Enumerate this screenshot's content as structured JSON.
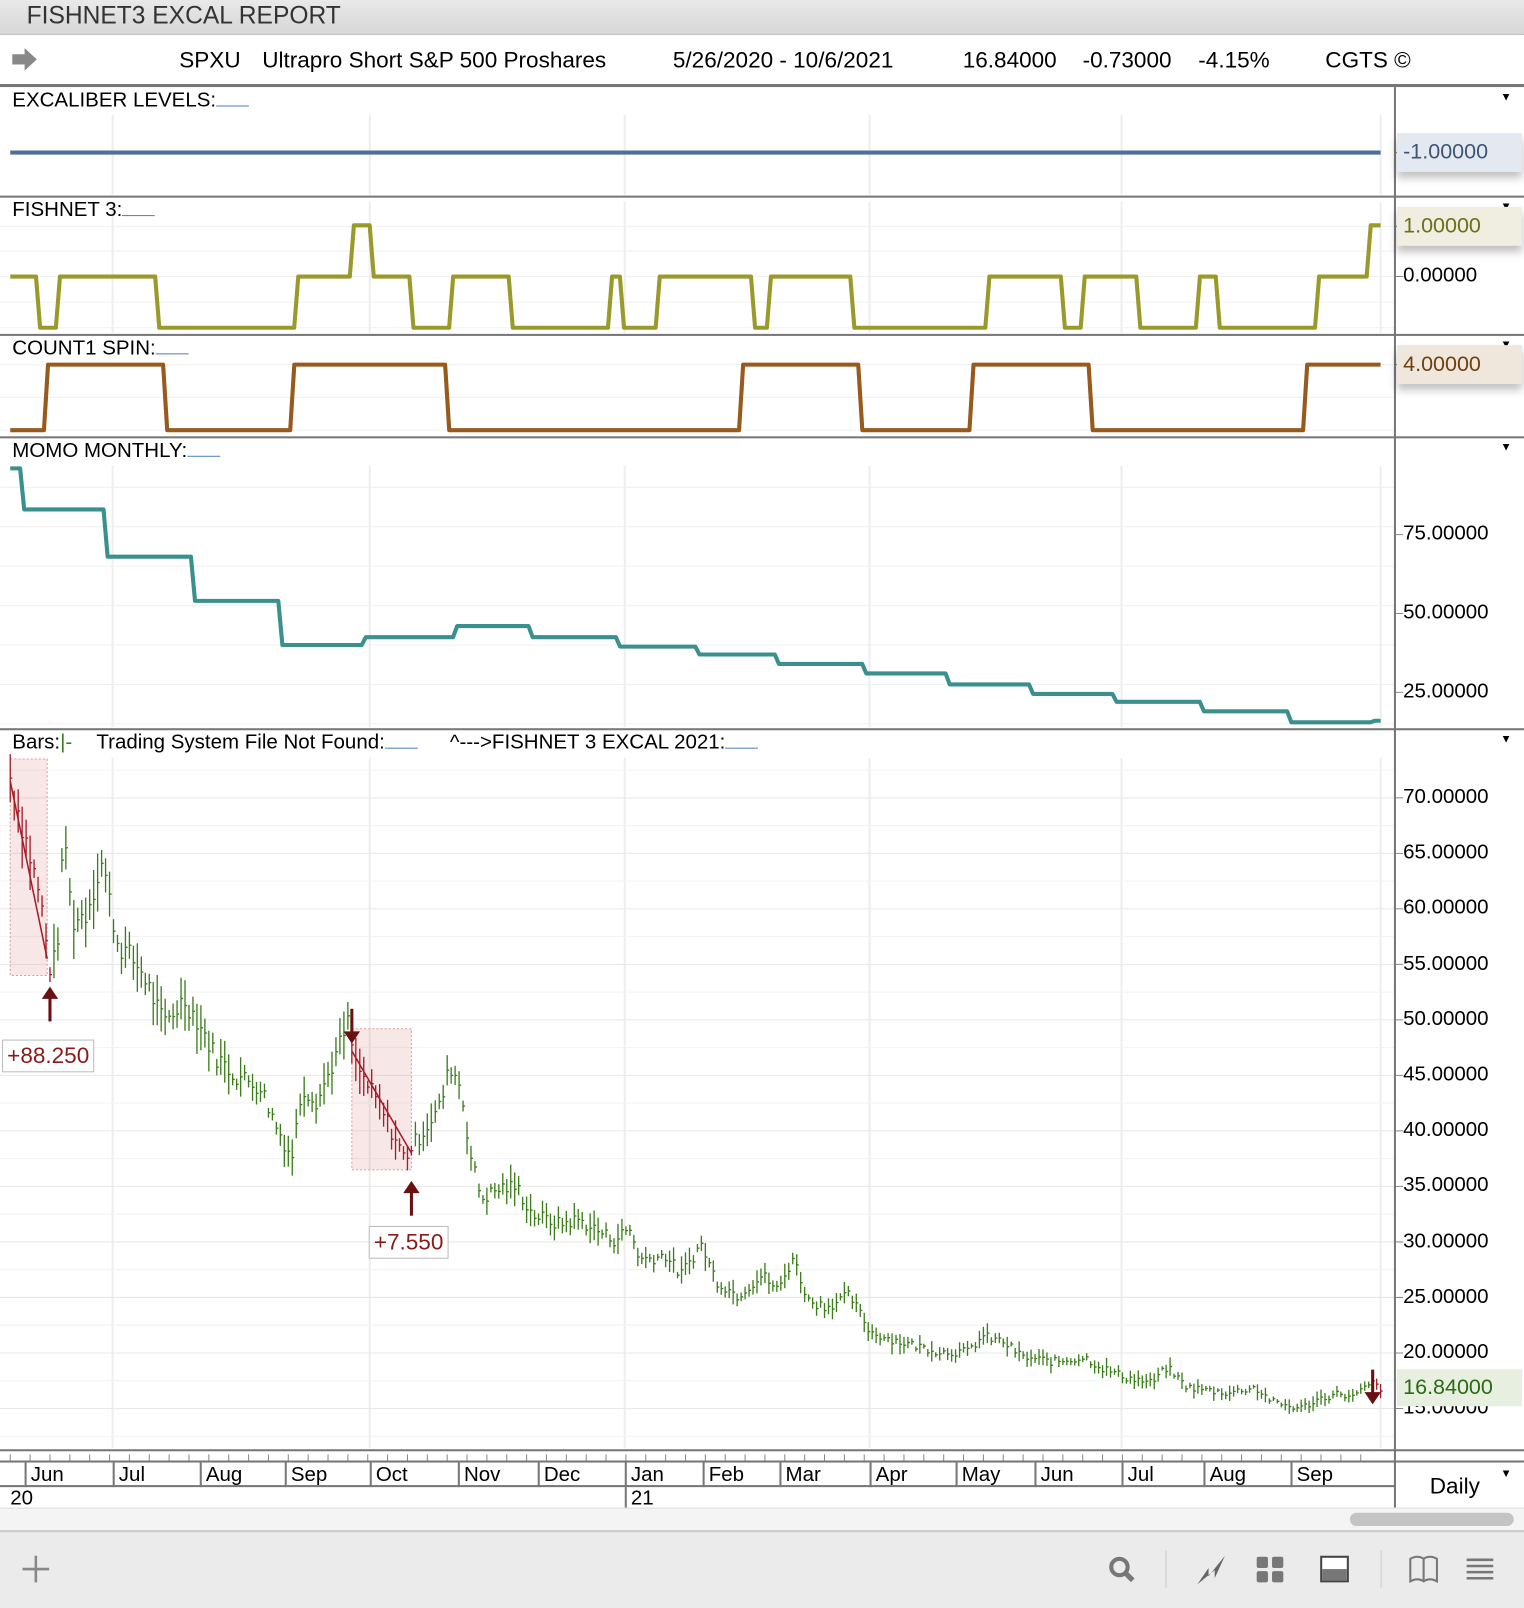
{
  "window": {
    "title": "FISHNET3 EXCAL REPORT"
  },
  "header": {
    "symbol": "SPXU",
    "name": "Ultrapro Short S&P 500 Proshares",
    "date_range": "5/26/2020 - 10/6/2021",
    "last": "16.84000",
    "change": "-0.73000",
    "change_pct": "-4.15%",
    "copyright": "CGTS ©"
  },
  "panels": {
    "excaliber": {
      "label": "EXCALIBER LEVELS:",
      "value_tag": "-1.00000",
      "color": "#4f6f9a"
    },
    "fishnet": {
      "label": "FISHNET 3:",
      "value_tag": "1.00000",
      "tick": "0.00000",
      "color": "#9a9a2a"
    },
    "count1": {
      "label": "COUNT1 SPIN:",
      "value_tag": "4.00000",
      "color": "#97591c"
    },
    "momo": {
      "label": "MOMO MONTHLY:",
      "ticks": [
        "75.00000",
        "50.00000",
        "25.00000"
      ],
      "color": "#3a8f8f"
    },
    "bars": {
      "label1": "Bars:",
      "label1b": "|-",
      "label2": "Trading System File Not Found:",
      "label3": "^--->FISHNET 3 EXCAL 2021:",
      "ticks": [
        "70.00000",
        "65.00000",
        "60.00000",
        "55.00000",
        "50.00000",
        "45.00000",
        "40.00000",
        "35.00000",
        "30.00000",
        "25.00000",
        "20.00000",
        "15.00000"
      ],
      "last_tag": "16.84000",
      "trades": [
        "+88.250",
        "+7.550"
      ]
    }
  },
  "xaxis": {
    "months": [
      "Jun",
      "Jul",
      "Aug",
      "Sep",
      "Oct",
      "Nov",
      "Dec",
      "Jan",
      "Feb",
      "Mar",
      "Apr",
      "May",
      "Jun",
      "Jul",
      "Aug",
      "Sep"
    ],
    "years": [
      "20",
      "21"
    ],
    "interval": "Daily"
  },
  "chart_data": [
    {
      "type": "line",
      "title": "EXCALIBER LEVELS",
      "x_units": "bar index (0-345)",
      "steps": [
        [
          0,
          -1
        ],
        [
          345,
          -1
        ]
      ]
    },
    {
      "type": "line",
      "title": "FISHNET 3",
      "steps": [
        [
          0,
          0
        ],
        [
          7,
          -1
        ],
        [
          12,
          0
        ],
        [
          37,
          -1
        ],
        [
          72,
          0
        ],
        [
          86,
          1
        ],
        [
          91,
          0
        ],
        [
          101,
          -1
        ],
        [
          111,
          0
        ],
        [
          126,
          -1
        ],
        [
          151,
          0
        ],
        [
          154,
          -1
        ],
        [
          163,
          0
        ],
        [
          187,
          -1
        ],
        [
          191,
          0
        ],
        [
          212,
          -1
        ],
        [
          246,
          0
        ],
        [
          265,
          -1
        ],
        [
          270,
          0
        ],
        [
          284,
          -1
        ],
        [
          299,
          0
        ],
        [
          304,
          -1
        ],
        [
          329,
          0
        ],
        [
          342,
          1
        ]
      ],
      "ylim": [
        -1,
        1
      ]
    },
    {
      "type": "line",
      "title": "COUNT1 SPIN",
      "steps": [
        [
          0,
          0
        ],
        [
          9,
          4
        ],
        [
          39,
          0
        ],
        [
          71,
          4
        ],
        [
          110,
          0
        ],
        [
          184,
          4
        ],
        [
          214,
          0
        ],
        [
          242,
          4
        ],
        [
          272,
          0
        ],
        [
          326,
          4
        ]
      ],
      "ylim": [
        0,
        4
      ]
    },
    {
      "type": "line",
      "title": "MOMO MONTHLY",
      "steps": [
        [
          0,
          96
        ],
        [
          3,
          83
        ],
        [
          24,
          68
        ],
        [
          46,
          54
        ],
        [
          68,
          40
        ],
        [
          89,
          42.5
        ],
        [
          112,
          46
        ],
        [
          131,
          42.5
        ],
        [
          153,
          39.5
        ],
        [
          173,
          37
        ],
        [
          193,
          34
        ],
        [
          215,
          31
        ],
        [
          236,
          27.5
        ],
        [
          257,
          24.5
        ],
        [
          278,
          22
        ],
        [
          300,
          19
        ],
        [
          322,
          15.5
        ],
        [
          343,
          16
        ]
      ],
      "ylim": [
        12,
        100
      ]
    },
    {
      "type": "line",
      "title": "SPXU Daily",
      "ylim": [
        12,
        73
      ],
      "close": [
        [
          0,
          71.8
        ],
        [
          4.6,
          65.3
        ],
        [
          7.7,
          60.7
        ],
        [
          9.8,
          54.7
        ],
        [
          11.6,
          55.5
        ],
        [
          13.7,
          67.1
        ],
        [
          15.5,
          58.8
        ],
        [
          19,
          59.6
        ],
        [
          23.2,
          64.4
        ],
        [
          25,
          60.7
        ],
        [
          27,
          57
        ],
        [
          33.5,
          54.2
        ],
        [
          38.6,
          49.6
        ],
        [
          43.8,
          51.9
        ],
        [
          47.7,
          49.6
        ],
        [
          51.5,
          46.8
        ],
        [
          56.7,
          45
        ],
        [
          63,
          44
        ],
        [
          67,
          40.4
        ],
        [
          70.9,
          37.6
        ],
        [
          73.5,
          44
        ],
        [
          77.3,
          42.7
        ],
        [
          81,
          45.9
        ],
        [
          85,
          49.6
        ],
        [
          87,
          45.9
        ],
        [
          93,
          42.2
        ],
        [
          99.2,
          37.6
        ],
        [
          103,
          39.5
        ],
        [
          108.2,
          42.2
        ],
        [
          110.8,
          45.9
        ],
        [
          113.4,
          44
        ],
        [
          116,
          37.6
        ],
        [
          118.6,
          33.9
        ],
        [
          123.7,
          34.9
        ],
        [
          127.6,
          34.9
        ],
        [
          131.4,
          32.5
        ],
        [
          137.9,
          31.6
        ],
        [
          143,
          32
        ],
        [
          146.9,
          31.2
        ],
        [
          152,
          30.2
        ],
        [
          155.9,
          31.2
        ],
        [
          158.5,
          28.4
        ],
        [
          165,
          28.8
        ],
        [
          168.8,
          27
        ],
        [
          173.9,
          29.8
        ],
        [
          177.8,
          26.5
        ],
        [
          183,
          25.2
        ],
        [
          189.4,
          27
        ],
        [
          193.3,
          25.6
        ],
        [
          197,
          28.6
        ],
        [
          201,
          24.7
        ],
        [
          205.7,
          24.2
        ],
        [
          211.3,
          25.2
        ],
        [
          216.5,
          21.9
        ],
        [
          224,
          21
        ],
        [
          234.5,
          20.1
        ],
        [
          241,
          20.1
        ],
        [
          244.8,
          21.5
        ],
        [
          250,
          21
        ],
        [
          255,
          19.6
        ],
        [
          262.9,
          19.2
        ],
        [
          270.6,
          19.6
        ],
        [
          274.5,
          18.7
        ],
        [
          281,
          17.8
        ],
        [
          287.4,
          17.3
        ],
        [
          291.2,
          18.7
        ],
        [
          296.4,
          16.9
        ],
        [
          306.7,
          16.4
        ],
        [
          313,
          16.9
        ],
        [
          318.3,
          15.5
        ],
        [
          324.7,
          15
        ],
        [
          329.9,
          15.9
        ],
        [
          335,
          16.4
        ],
        [
          337.6,
          15.9
        ],
        [
          342.8,
          17.3
        ],
        [
          345,
          16.84
        ]
      ],
      "trades": [
        {
          "entry": [
            0,
            73.5
          ],
          "exit": [
            9.3,
            54
          ],
          "result": "+88.250"
        },
        {
          "entry": [
            86,
            49.2
          ],
          "exit": [
            101,
            36.5
          ],
          "result": "+7.550"
        }
      ],
      "signals": [
        {
          "type": "up",
          "x": 10,
          "y": 53
        },
        {
          "type": "down",
          "x": 86,
          "y": 51
        },
        {
          "type": "up",
          "x": 101,
          "y": 35.5
        },
        {
          "type": "down",
          "x": 343,
          "y": 18.5
        }
      ]
    }
  ]
}
